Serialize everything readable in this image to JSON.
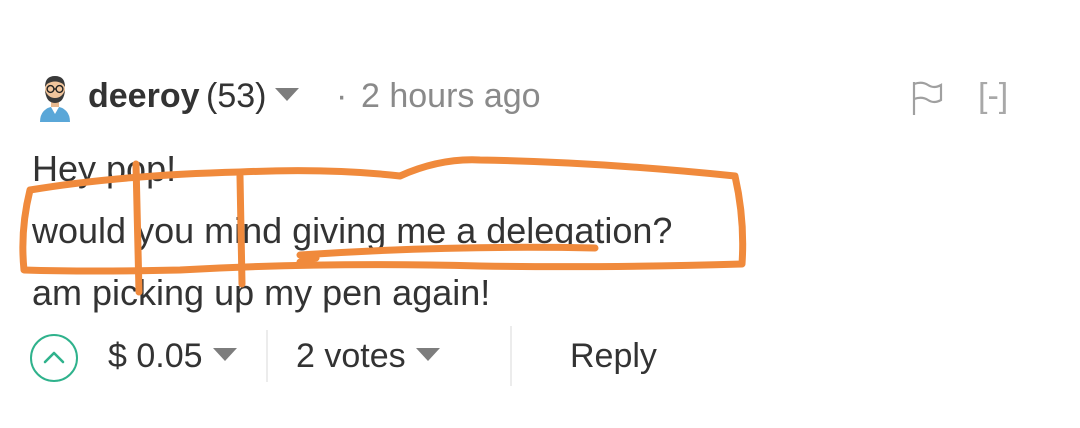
{
  "comment": {
    "author": {
      "name": "deeroy",
      "reputation": "(53)",
      "avatar_icon": "bearded-man-avatar-icon"
    },
    "separator_dot": "·",
    "timestamp": "2 hours ago",
    "flag_icon": "flag-icon",
    "collapse_label": "[-]",
    "body_lines": [
      "Hey pop!",
      "would you mind giving me a delegation?",
      "am picking up my pen again!"
    ],
    "footer": {
      "upvote_icon": "chevron-up-circle-icon",
      "payout": "$ 0.05",
      "votes": "2 votes",
      "reply_label": "Reply"
    }
  },
  "colors": {
    "upvote_accent": "#2fb28c",
    "annotation_stroke": "#f08a3c",
    "muted_text": "#8a8a8a"
  }
}
